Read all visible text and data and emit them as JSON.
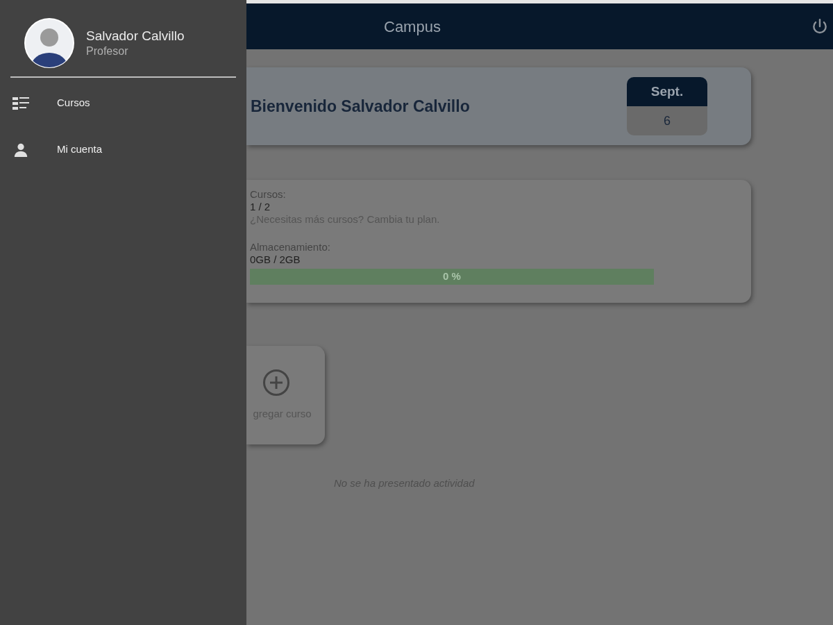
{
  "header": {
    "title": "Campus"
  },
  "drawer": {
    "user": {
      "name": "Salvador Calvillo",
      "role": "Profesor"
    },
    "items": [
      {
        "label": "Cursos",
        "kind": "list",
        "selected": false
      },
      {
        "label": "Mi cuenta",
        "kind": "person",
        "selected": false
      }
    ]
  },
  "welcome": {
    "text": "Bienvenido Salvador Calvillo",
    "month": "Sept.",
    "day": "6"
  },
  "plan": {
    "courses_label": "Cursos:",
    "courses_value": "1 / 2",
    "upgrade_text": "¿Necesitas más cursos? Cambia tu plan.",
    "storage_label": "Almacenamiento:",
    "storage_value": "0GB / 2GB",
    "storage": {
      "level": 0,
      "reading": "0 %"
    }
  },
  "add_course": {
    "label": "gregar curso"
  },
  "activity": {
    "empty_text": "No se ha presentado actividad"
  }
}
